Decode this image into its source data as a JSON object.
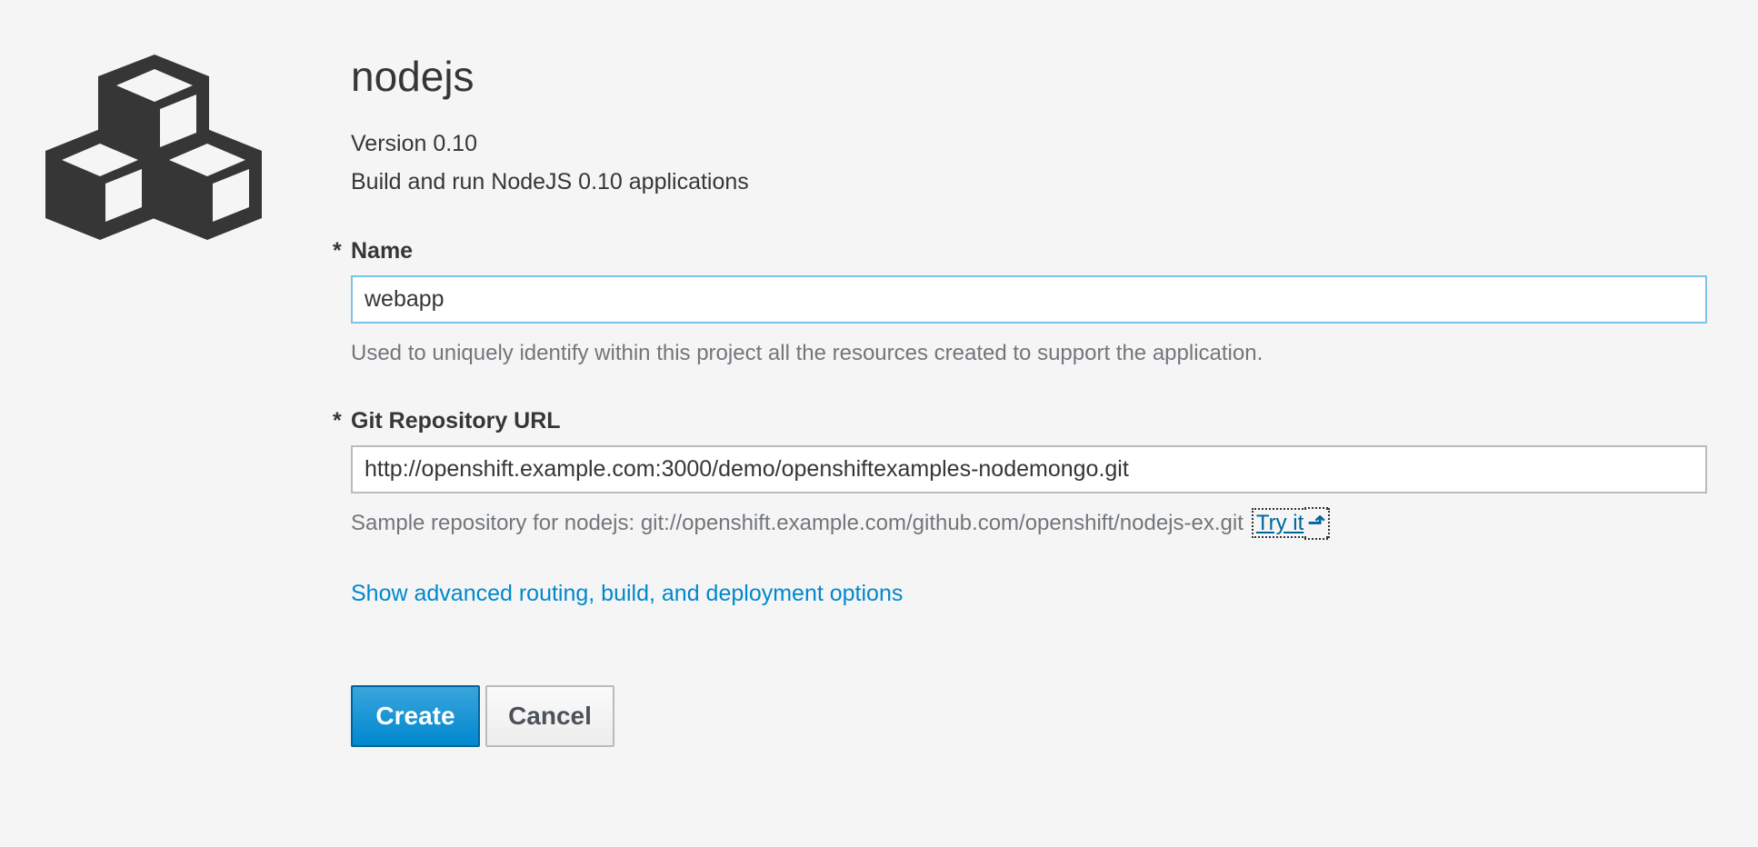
{
  "app": {
    "title": "nodejs",
    "version_text": "Version 0.10",
    "description": "Build and run NodeJS 0.10 applications",
    "icon": "cubes-icon"
  },
  "form": {
    "required_marker": "*",
    "name": {
      "label": "Name",
      "value": "webapp",
      "help": "Used to uniquely identify within this project all the resources created to support the application."
    },
    "git": {
      "label": "Git Repository URL",
      "value": "http://openshift.example.com:3000/demo/openshiftexamples-nodemongo.git",
      "help": "Sample repository for nodejs: git://openshift.example.com/github.com/openshift/nodejs-ex.git",
      "try_label": "Try it",
      "try_icon": "level-up-icon"
    },
    "advanced_link": "Show advanced routing, build, and deployment options"
  },
  "buttons": {
    "create": "Create",
    "cancel": "Cancel"
  },
  "colors": {
    "background": "#f5f5f5",
    "link": "#0088ce",
    "primary": "#0088ce",
    "icon": "#363636"
  }
}
